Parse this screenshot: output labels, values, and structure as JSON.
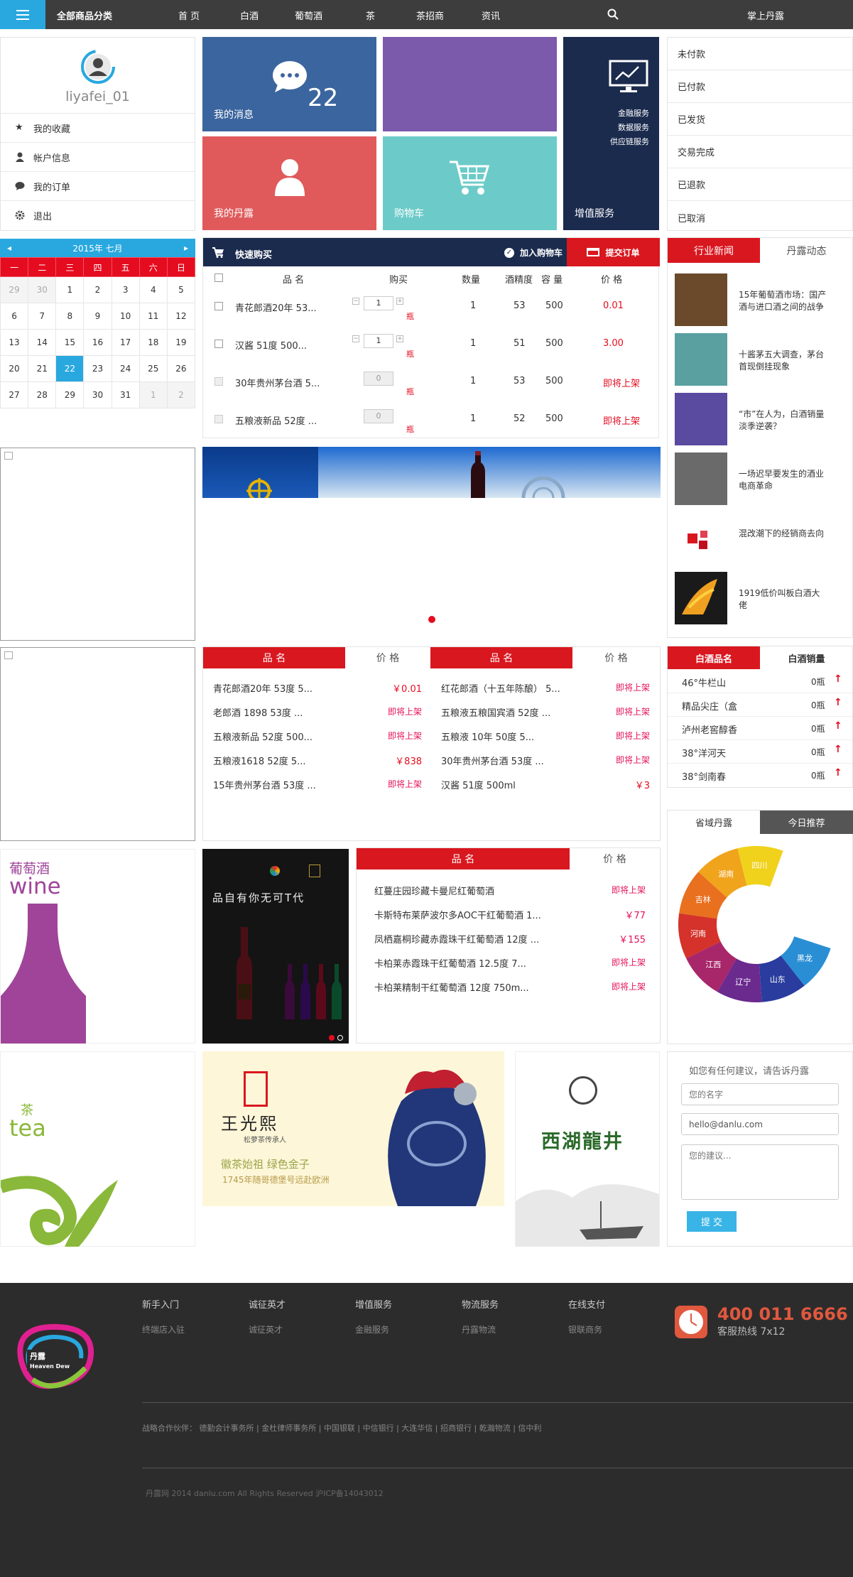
{
  "topbar": {
    "all_categories": "全部商品分类",
    "nav": [
      "首 页",
      "白酒",
      "葡萄酒",
      "茶",
      "茶招商",
      "资讯"
    ],
    "brand_right": "掌上丹露"
  },
  "user": {
    "name": "liyafei_01",
    "menu": [
      "我的收藏",
      "帐户信息",
      "我的订单",
      "退出"
    ]
  },
  "tiles": {
    "messages_label": "我的消息",
    "messages_count": "22",
    "danlu_label": "我的丹露",
    "cart_label": "购物车",
    "value_title": "增值服务",
    "value_items": [
      "金融服务",
      "数据服务",
      "供应链服务"
    ]
  },
  "order_status": [
    "未付款",
    "已付款",
    "已发货",
    "交易完成",
    "已退款",
    "已取消"
  ],
  "calendar": {
    "title": "2015年 七月",
    "weekdays": [
      "一",
      "二",
      "三",
      "四",
      "五",
      "六",
      "日"
    ],
    "weeks": [
      [
        "29",
        "30",
        "1",
        "2",
        "3",
        "4",
        "5"
      ],
      [
        "6",
        "7",
        "8",
        "9",
        "10",
        "11",
        "12"
      ],
      [
        "13",
        "14",
        "15",
        "16",
        "17",
        "18",
        "19"
      ],
      [
        "20",
        "21",
        "22",
        "23",
        "24",
        "25",
        "26"
      ],
      [
        "27",
        "28",
        "29",
        "30",
        "31",
        "1",
        "2"
      ]
    ],
    "today": "22"
  },
  "quick_buy": {
    "title": "快速购买",
    "add_cart": "加入购物车",
    "submit": "提交订单",
    "headers": [
      "品 名",
      "购买",
      "数量",
      "酒精度",
      "容 量",
      "价 格"
    ],
    "rows": [
      {
        "name": "青花郎酒20年 53...",
        "qty_input": "1",
        "unit": "瓶",
        "qty": "1",
        "abv": "53",
        "vol": "500",
        "price": "0.01"
      },
      {
        "name": "汉酱 51度 500...",
        "qty_input": "1",
        "unit": "瓶",
        "qty": "1",
        "abv": "51",
        "vol": "500",
        "price": "3.00"
      },
      {
        "name": "30年贵州茅台酒 5...",
        "qty_input": "0",
        "unit": "瓶",
        "qty": "1",
        "abv": "53",
        "vol": "500",
        "price": "即将上架"
      },
      {
        "name": "五粮液新品 52度 ...",
        "qty_input": "0",
        "unit": "瓶",
        "qty": "1",
        "abv": "52",
        "vol": "500",
        "price": "即将上架"
      }
    ]
  },
  "news": {
    "tabs": [
      "行业新闻",
      "丹露动态"
    ],
    "items": [
      "15年葡萄酒市场：国产酒与进口酒之间的战争",
      "十酱茅五大调查，茅台首现倒挂现象",
      "“市”在人为，白酒销量淡季逆袭？",
      "一场迟早要发生的酒业电商革命",
      "混改潮下的经销商去向",
      "1919低价叫板白酒大佬"
    ]
  },
  "price_tables": {
    "left": {
      "headers": [
        "品 名",
        "价 格"
      ],
      "rows": [
        [
          "青花郎酒20年 53度 5...",
          "￥0.01"
        ],
        [
          "老郎酒 1898 53度 ...",
          "即将上架"
        ],
        [
          "五粮液新品 52度 500...",
          "即将上架"
        ],
        [
          "五粮液1618 52度 5...",
          "￥838"
        ],
        [
          "15年贵州茅台酒 53度 ...",
          "即将上架"
        ]
      ]
    },
    "right": {
      "headers": [
        "品 名",
        "价 格"
      ],
      "rows": [
        [
          "红花郎酒（十五年陈酿） 5...",
          "即将上架"
        ],
        [
          "五粮液五粮国宾酒 52度 ...",
          "即将上架"
        ],
        [
          "五粮液 10年 50度 5...",
          "即将上架"
        ],
        [
          "30年贵州茅台酒 53度 ...",
          "即将上架"
        ],
        [
          "汉酱 51度 500ml",
          "￥3"
        ]
      ]
    }
  },
  "rank": {
    "tabs": [
      "白酒品名",
      "白酒销量"
    ],
    "rows": [
      [
        "46°牛栏山",
        "0瓶"
      ],
      [
        "精品尖庄（盒",
        "0瓶"
      ],
      [
        "泸州老窖醇香",
        "0瓶"
      ],
      [
        "38°洋河天",
        "0瓶"
      ],
      [
        "38°剑南春",
        "0瓶"
      ]
    ]
  },
  "wine": {
    "cn": "葡萄酒",
    "en": "wine",
    "ad_text": "品自有你无可T代",
    "headers": [
      "品 名",
      "价 格"
    ],
    "rows": [
      [
        "红蔓庄园珍藏卡曼尼红葡萄酒",
        "即将上架"
      ],
      [
        "卡斯特布莱萨波尔多AOC干红葡萄酒 1...",
        "￥77"
      ],
      [
        "凤栖嘉桐珍藏赤霞珠干红葡萄酒 12度 ...",
        "￥155"
      ],
      [
        "卡柏莱赤霞珠干红葡萄酒 12.5度 7...",
        "即将上架"
      ],
      [
        "卡柏莱精制干红葡萄酒 12度 750m...",
        "即将上架"
      ]
    ]
  },
  "province": {
    "tabs": [
      "省域丹露",
      "今日推荐"
    ],
    "segments": [
      {
        "label": "四川",
        "color": "#f0d21c"
      },
      {
        "label": "湖南",
        "color": "#f0a41c"
      },
      {
        "label": "吉林",
        "color": "#e8701e"
      },
      {
        "label": "河南",
        "color": "#d4322a"
      },
      {
        "label": "江西",
        "color": "#a8266a"
      },
      {
        "label": "辽宁",
        "color": "#6a2a8e"
      },
      {
        "label": "山东",
        "color": "#2a3c9e"
      },
      {
        "label": "黑龙",
        "color": "#2a8ed4"
      }
    ]
  },
  "tea": {
    "cn": "茶",
    "en": "tea",
    "ad1_brand": "王光熙",
    "ad1_sub": "松萝茶传承人",
    "ad1_slogan": "徽茶始祖  绿色金子",
    "ad1_line": "1745年随哥德堡号远赴欧洲",
    "ad2_title": "西湖龍井"
  },
  "feedback": {
    "title": "如您有任何建议，请告诉丹露",
    "name_placeholder": "您的名字",
    "email_value": "hello@danlu.com",
    "suggest_placeholder": "您的建议...",
    "submit": "提 交"
  },
  "footer": {
    "logo_cn": "丹露",
    "logo_en": "Heaven Dew",
    "cols": [
      {
        "h": "新手入门",
        "i": "终端店入驻"
      },
      {
        "h": "诚征英才",
        "i": "诚征英才"
      },
      {
        "h": "增值服务",
        "i": "金融服务"
      },
      {
        "h": "物流服务",
        "i": "丹露物流"
      },
      {
        "h": "在线支付",
        "i": "银联商务"
      }
    ],
    "phone": "400 011 6666",
    "hotline": "客服热线 7x12",
    "partners_label": "战略合作伙伴：",
    "partners": "德勤会计事务所 |  金杜律师事务所 |  中国银联 |  中信银行 |  大连华信 |  招商银行 |  乾瀚物流 |  信中利",
    "copyright": "丹露网   2014 danlu.com All Rights Reserved    沪ICP备14043012"
  },
  "colors": {
    "accent": "#29a8e0",
    "red": "#d9171f",
    "navy": "#1b2b4e"
  }
}
